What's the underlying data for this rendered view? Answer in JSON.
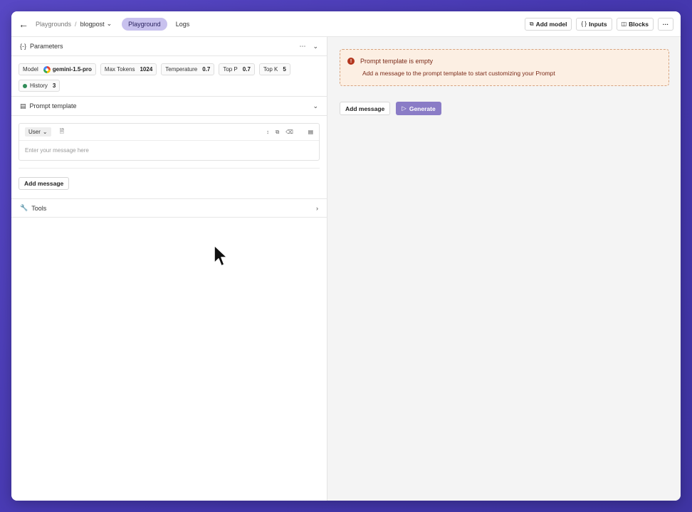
{
  "topbar": {
    "breadcrumb_root": "Playgrounds",
    "breadcrumb_sep": "/",
    "breadcrumb_current": "blogpost",
    "tabs": [
      {
        "label": "Playground"
      },
      {
        "label": "Logs"
      }
    ],
    "buttons": {
      "add_model": "Add model",
      "inputs": "Inputs",
      "blocks": "Blocks",
      "more": "···"
    }
  },
  "parameters": {
    "title": "Parameters",
    "chips": [
      {
        "label": "Model",
        "value": "gemini-1.5-pro"
      },
      {
        "label": "Max Tokens",
        "value": "1024"
      },
      {
        "label": "Temperature",
        "value": "0.7"
      },
      {
        "label": "Top P",
        "value": "0.7"
      },
      {
        "label": "Top K",
        "value": "5"
      },
      {
        "label": "History",
        "value": "3"
      }
    ]
  },
  "prompt_template": {
    "title": "Prompt template",
    "message": {
      "role": "User",
      "placeholder": "Enter your message here"
    },
    "add_message": "Add message"
  },
  "tools": {
    "title": "Tools"
  },
  "main": {
    "alert": {
      "title": "Prompt template is empty",
      "body": "Add a message to the prompt template to start customizing your Prompt"
    },
    "add_message": "Add message",
    "generate": "Generate"
  },
  "colors": {
    "accent": "#c8c1ee",
    "generate": "#8a7cc6",
    "alert_bg": "#fcefe3",
    "alert_text": "#7a2a18"
  }
}
